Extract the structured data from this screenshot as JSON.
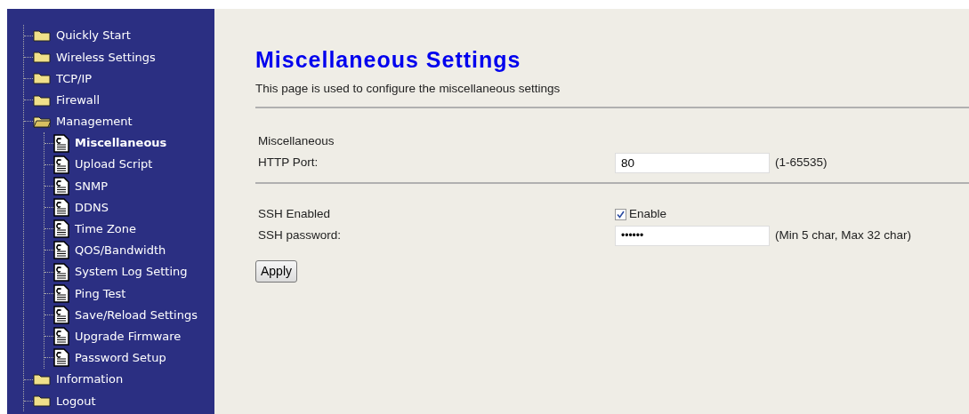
{
  "sidebar": {
    "items": [
      {
        "label": "Quickly Start",
        "selected": false
      },
      {
        "label": "Wireless Settings",
        "selected": false
      },
      {
        "label": "TCP/IP",
        "selected": false
      },
      {
        "label": "Firewall",
        "selected": false
      },
      {
        "label": "Management",
        "selected": false,
        "expanded": true,
        "children": [
          {
            "label": "Miscellaneous",
            "selected": true
          },
          {
            "label": "Upload Script",
            "selected": false
          },
          {
            "label": "SNMP",
            "selected": false
          },
          {
            "label": "DDNS",
            "selected": false
          },
          {
            "label": "Time Zone",
            "selected": false
          },
          {
            "label": "QOS/Bandwidth",
            "selected": false
          },
          {
            "label": "System Log Setting",
            "selected": false
          },
          {
            "label": "Ping Test",
            "selected": false
          },
          {
            "label": "Save/Reload Settings",
            "selected": false
          },
          {
            "label": "Upgrade Firmware",
            "selected": false
          },
          {
            "label": "Password Setup",
            "selected": false
          }
        ]
      },
      {
        "label": "Information",
        "selected": false
      },
      {
        "label": "Logout",
        "selected": false
      }
    ]
  },
  "page": {
    "title": "Miscellaneous Settings",
    "description": "This page is used to configure the miscellaneous settings"
  },
  "sections": [
    {
      "heading": "Miscellaneous",
      "fields": [
        {
          "kind": "text",
          "label": "HTTP Port:",
          "value": "80",
          "hint": "(1-65535)"
        }
      ]
    },
    {
      "fields": [
        {
          "kind": "checkbox",
          "label": "SSH Enabled",
          "checked": true,
          "option": "Enable"
        },
        {
          "kind": "password",
          "label": "SSH password:",
          "value": "••••••",
          "hint": "(Min 5 char, Max 32 char)"
        }
      ]
    }
  ],
  "apply_button": "Apply"
}
